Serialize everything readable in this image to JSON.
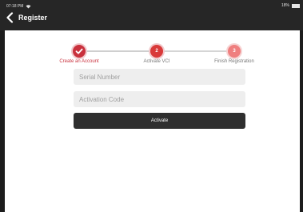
{
  "status_bar": {
    "time": "07:18 PM",
    "battery": "18%",
    "wifi_icon": "wifi-icon",
    "battery_icon": "battery-icon"
  },
  "header": {
    "title": "Register",
    "back_icon": "chevron-left-icon"
  },
  "steps": [
    {
      "number": "",
      "label": "Create an Account",
      "state": "completed",
      "icon": "check-icon"
    },
    {
      "number": "2",
      "label": "Activate VCI",
      "state": "current"
    },
    {
      "number": "3",
      "label": "Finish Registration",
      "state": "pending"
    }
  ],
  "form": {
    "serial_number": {
      "placeholder": "Serial Number",
      "value": ""
    },
    "activation_code": {
      "placeholder": "Activation Code",
      "value": ""
    },
    "activate_label": "Activate"
  },
  "colors": {
    "header_bg": "#262626",
    "accent_red": "#c9313d",
    "input_bg": "#eeeeee",
    "button_bg": "#2f2f2f"
  }
}
